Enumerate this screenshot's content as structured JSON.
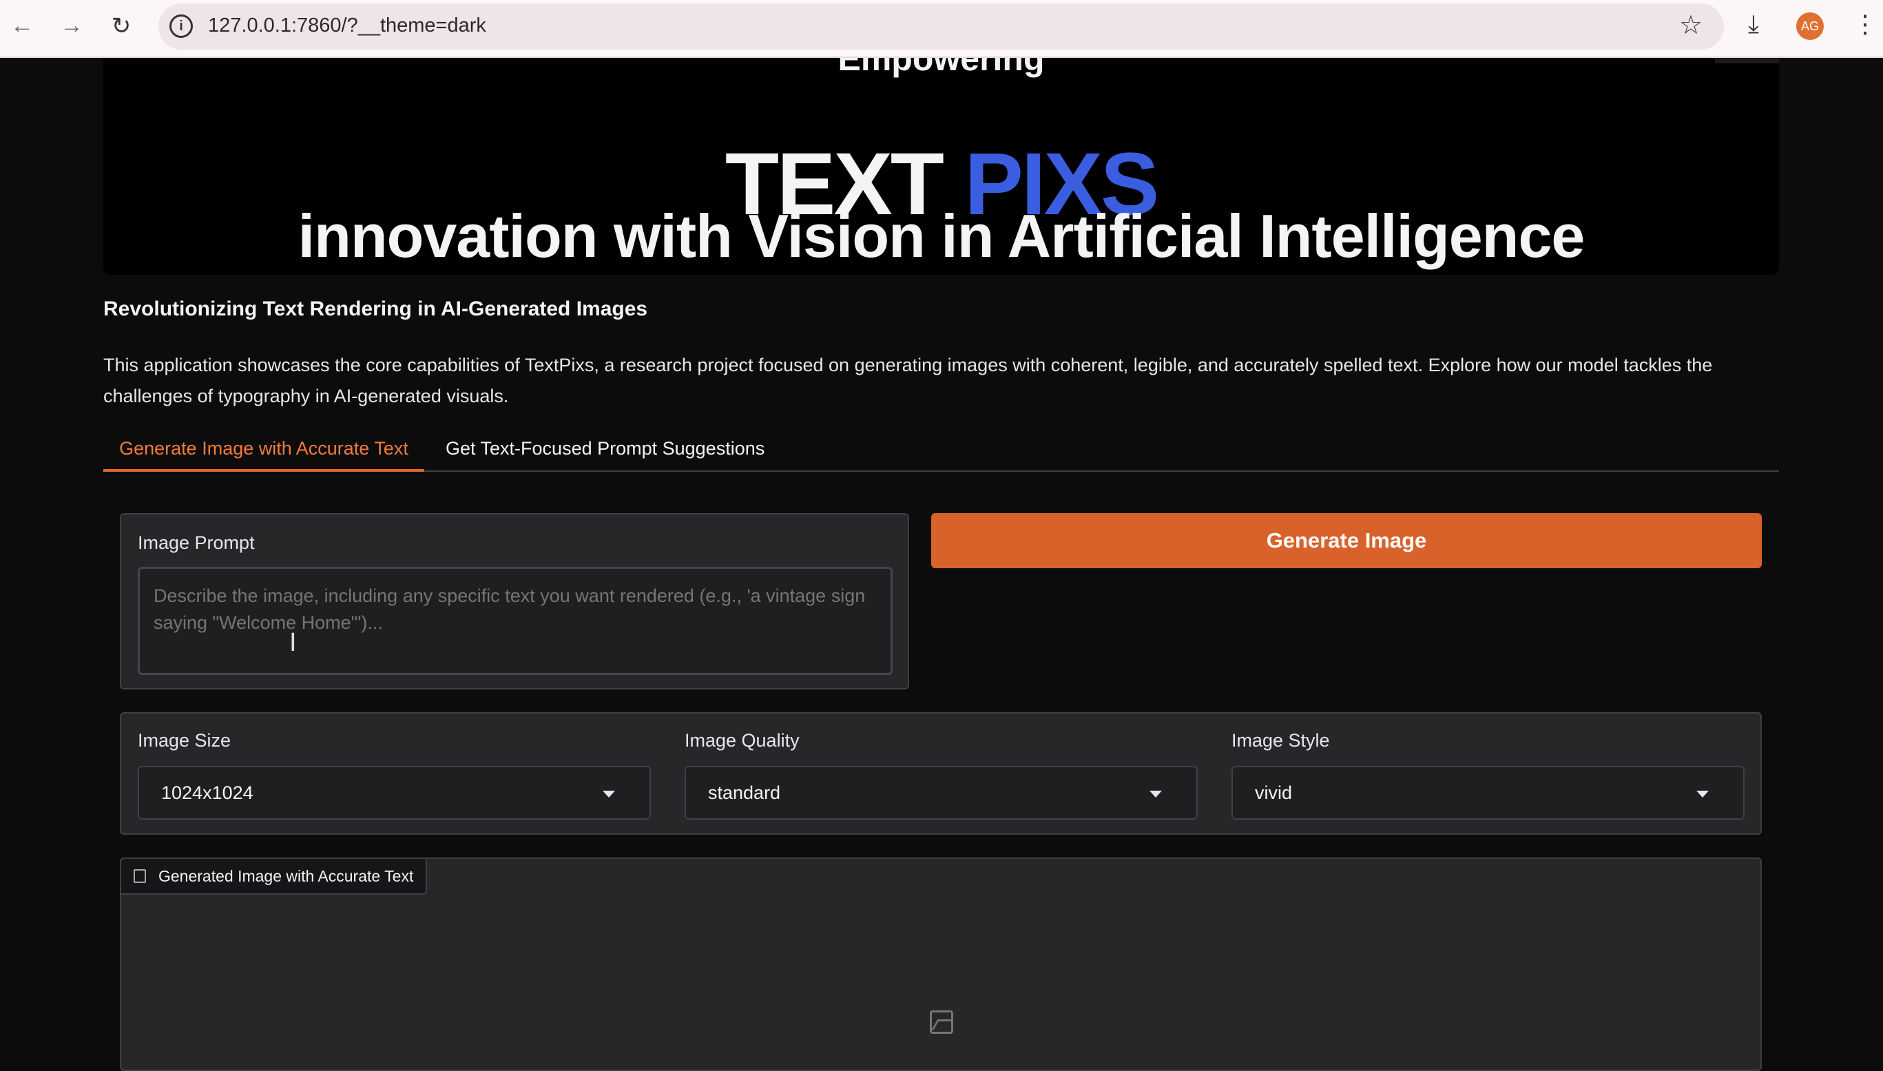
{
  "browser": {
    "url": "127.0.0.1:7860/?__theme=dark",
    "avatar": "AG"
  },
  "banner": {
    "top_word": "Empowering",
    "title_a": "TEXT",
    "title_b": "PIXS",
    "tagline": "innovation with Vision in Artificial Intelligence"
  },
  "heading": "Revolutionizing Text Rendering in AI-Generated Images",
  "description": "This application showcases the core capabilities of TextPixs, a research project focused on generating images with coherent, legible, and accurately spelled text. Explore how our model tackles the challenges of typography in AI-generated visuals.",
  "tabs": [
    {
      "label": "Generate Image with Accurate Text",
      "active": true
    },
    {
      "label": "Get Text-Focused Prompt Suggestions",
      "active": false
    }
  ],
  "prompt": {
    "label": "Image Prompt",
    "value": "",
    "placeholder": "Describe the image, including any specific text you want rendered (e.g., 'a vintage sign saying \"Welcome Home\"')..."
  },
  "generate_button": "Generate Image",
  "options": {
    "size": {
      "label": "Image Size",
      "value": "1024x1024"
    },
    "quality": {
      "label": "Image Quality",
      "value": "standard"
    },
    "style": {
      "label": "Image Style",
      "value": "vivid"
    }
  },
  "output": {
    "label": "Generated Image with Accurate Text"
  },
  "colors": {
    "accent": "#d9622b",
    "title_blue": "#3b5ee0"
  }
}
